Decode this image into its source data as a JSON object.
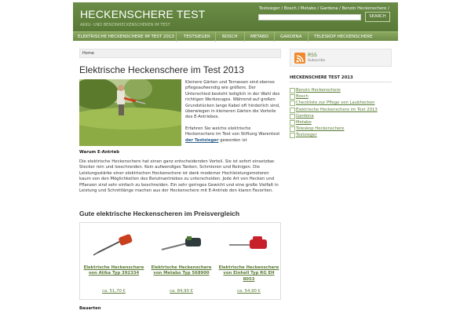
{
  "header": {
    "title": "HECKENSCHERE TEST",
    "description": "AKKU- UND BENZINHECKENSCHEREN IM TEST",
    "top_links": "Testsieger / Bosch / Metabo / Gardena / Benzin Heckenschere /",
    "search_button": "SEARCH",
    "search_value": ""
  },
  "nav": {
    "items": [
      "ELEKTRISCHE HECKENSCHERE IM TEST 2013",
      "TESTSIEGER",
      "BOSCH",
      "METABO",
      "GARDENA",
      "TELESKOP HECKENSCHERE"
    ]
  },
  "main": {
    "breadcrumb": "Home",
    "title": "Elektrische Heckenschere im Test 2013",
    "paragraph1": "Kleinere Gärten und Terrassen sind ebenso pflegeaufwendig wie größere. Der Unterschied besteht lediglich in der Wahl des richtigen Werkzeuges. Während auf großen Grundstücken lange Kabel oft hinderlich sind, überwiegen in kleineren Gärten die Vorteile des E-Antriebes.",
    "paragraph2_pre": "Erfahren Sie welche elektrische Heckenschere im Test von Stiftung Warentest",
    "paragraph2_link": "der Testsieger",
    "paragraph2_post": "geworden ist",
    "subheading1": "Warum E-Antrieb",
    "paragraph3": "Die elektrische Heckenschere hat einen ganz entscheidenden Vorteil. Sie ist sofort einsetzbar. Stecker rein und losschneiden. Kein aufwendiges Tanken, Schmieren und Reinigen. Die Leistungsstärke einer elektrischen Heckenschere ist dank moderner Hochleistungsmotoren kaum von den Möglichkeiten des Benzinantriebes zu unterscheiden. Jede Art von Hecken und Pflanzen sind sehr einfach zu beschneiden. Ein sehr geringes Gewicht und eine große Vielfalt in Leistung und Schnittlänge machen aus der Heckenschere mit E-Antrieb den klaren Favoriten.",
    "comparison_heading": "Gute elektrische Heckenscheren im Preisvergleich",
    "products": [
      {
        "title": "Elektrische Heckenschere von Atika Typ 392334",
        "price": "ca. 51,70 €",
        "color": "#c9401f"
      },
      {
        "title": "Elektrische Heckenschere von Metabo Typ 568900",
        "price": "ca. 84,90 €",
        "color": "#2f3a3c"
      },
      {
        "title": "Elektrische Heckenschere von Einhell Typ RG EH 8053",
        "price": "ca. 54,90 €",
        "color": "#c8202a"
      }
    ],
    "subheading2": "Bauarten"
  },
  "sidebar": {
    "rss_title": "RSS",
    "rss_sub": "Subscribe",
    "heading": "HECKENSCHERE TEST 2013",
    "items": [
      "Benzin Heckenschere",
      "Bosch",
      "Checkliste zur Pflege von Laubhecken",
      "Elektrische Heckenschere im Test 2013",
      "Gardena",
      "Metabo",
      "Teleskop Heckenschere",
      "Testsieger"
    ]
  }
}
